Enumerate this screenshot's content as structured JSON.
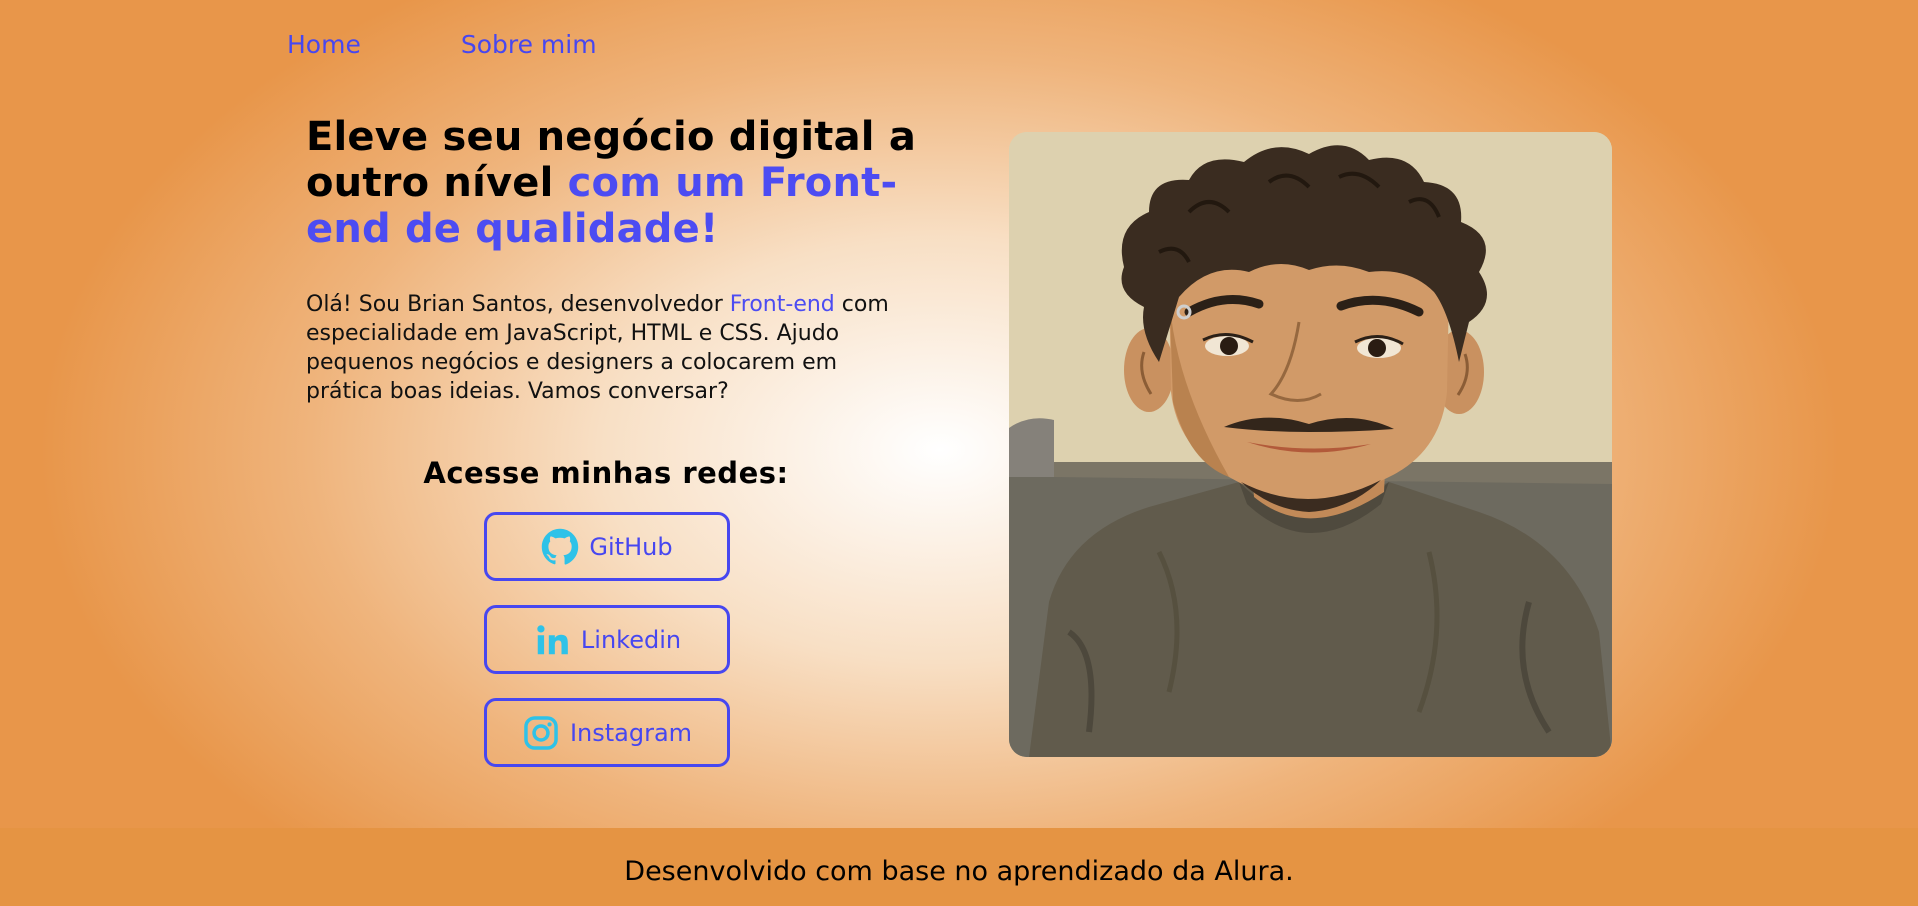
{
  "nav": {
    "items": [
      {
        "label": "Home"
      },
      {
        "label": "Sobre mim"
      }
    ]
  },
  "hero": {
    "headline_part1": "Eleve seu negócio digital a outro nível ",
    "headline_accent": "com um Front-end de qualidade!",
    "intro_part1": "Olá! Sou Brian Santos, desenvolvedor ",
    "intro_accent": "Front-end",
    "intro_part2": " com especialidade em JavaScript, HTML e CSS. Ajudo pequenos negócios e designers a colocarem em prática boas ideias. Vamos conversar?"
  },
  "socials": {
    "title": "Acesse minhas redes:",
    "links": [
      {
        "label": "GitHub",
        "icon": "github-icon"
      },
      {
        "label": "Linkedin",
        "icon": "linkedin-icon"
      },
      {
        "label": "Instagram",
        "icon": "instagram-icon"
      }
    ]
  },
  "portrait": {
    "description_icon": "profile-illustration"
  },
  "footer": {
    "text": "Desenvolvido com base no aprendizado da Alura."
  },
  "colors": {
    "accent": "#4747f0",
    "icon_cyan": "#2ec2e8",
    "footer_bg": "#e59443",
    "background_edge": "#e8964a"
  }
}
